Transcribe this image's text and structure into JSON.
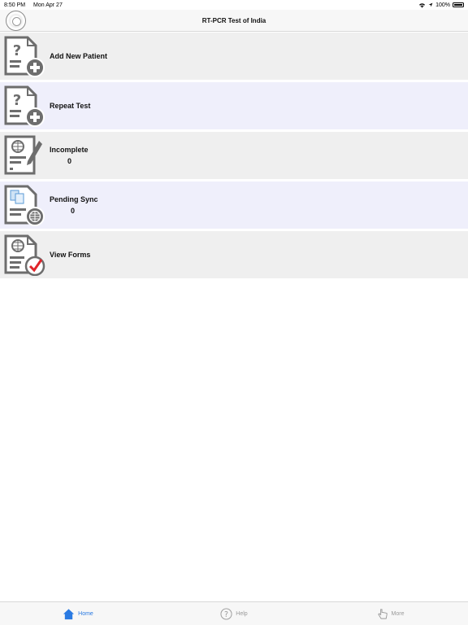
{
  "status": {
    "time": "8:50 PM",
    "date": "Mon Apr 27",
    "battery": "100%"
  },
  "nav": {
    "title": "RT-PCR Test of India"
  },
  "menu": [
    {
      "label": "Add New Patient",
      "count": null,
      "icon": "doc-question-plus-icon"
    },
    {
      "label": "Repeat Test",
      "count": null,
      "icon": "doc-question-plus-icon"
    },
    {
      "label": "Incomplete",
      "count": "0",
      "icon": "doc-globe-pencil-icon"
    },
    {
      "label": "Pending Sync",
      "count": "0",
      "icon": "doc-sync-globe-icon"
    },
    {
      "label": "View Forms",
      "count": null,
      "icon": "doc-globe-check-icon"
    }
  ],
  "tabs": [
    {
      "label": "Home",
      "icon": "home-icon",
      "active": true
    },
    {
      "label": "Help",
      "icon": "help-icon",
      "active": false
    },
    {
      "label": "More",
      "icon": "hand-pointer-icon",
      "active": false
    }
  ],
  "colors": {
    "accent": "#2a7ae2",
    "row_gray": "#efefef",
    "row_lavender": "#efeffb",
    "icon_gray": "#6d6d6d",
    "check_red": "#e0242a"
  }
}
